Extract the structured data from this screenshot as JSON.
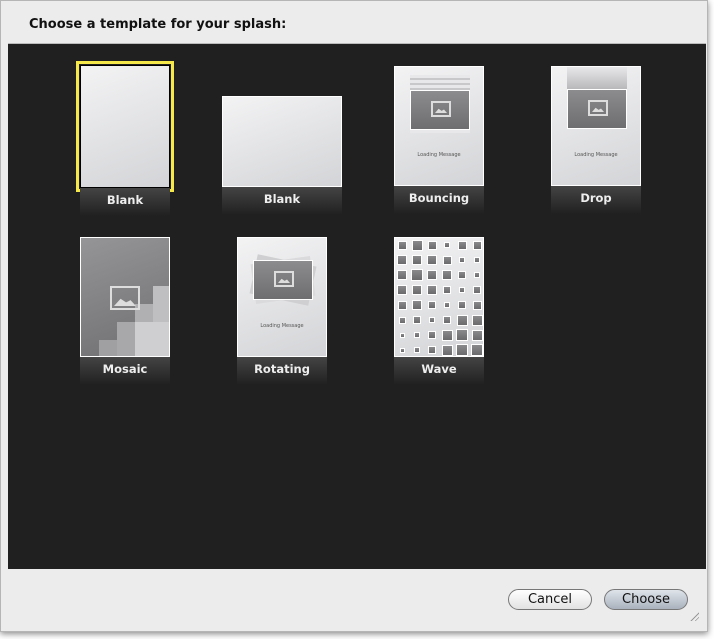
{
  "dialog": {
    "title": "Choose a template for your splash:"
  },
  "templates": [
    {
      "label": "Blank",
      "selected": true
    },
    {
      "label": "Blank",
      "selected": false
    },
    {
      "label": "Bouncing",
      "selected": false,
      "message": "Loading Message"
    },
    {
      "label": "Drop",
      "selected": false,
      "message": "Loading Message"
    },
    {
      "label": "Mosaic",
      "selected": false
    },
    {
      "label": "Rotating",
      "selected": false,
      "message": "Loading Message"
    },
    {
      "label": "Wave",
      "selected": false
    }
  ],
  "buttons": {
    "cancel": "Cancel",
    "choose": "Choose"
  },
  "colors": {
    "selection": "#f4e84a",
    "grid_bg": "#202020"
  }
}
